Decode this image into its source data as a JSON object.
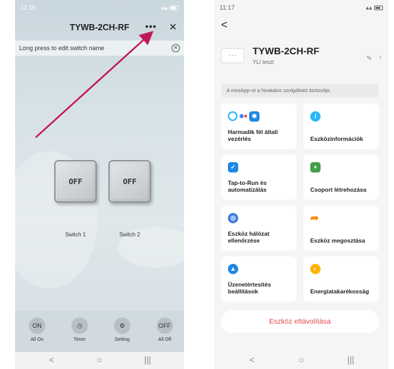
{
  "left": {
    "status_time": "11:16",
    "title": "TYWB-2CH-RF",
    "more_label": "•••",
    "close_label": "✕",
    "notice": "Long press to edit switch name",
    "switches": [
      {
        "state": "OFF",
        "label": "Switch 1"
      },
      {
        "state": "OFF",
        "label": "Switch 2"
      }
    ],
    "bottom_bar": [
      {
        "glyph": "ON",
        "label": "All On"
      },
      {
        "glyph": "◷",
        "label": "Timer"
      },
      {
        "glyph": "⚙",
        "label": "Setting"
      },
      {
        "glyph": "OFF",
        "label": "All Off"
      }
    ],
    "nav": [
      "<",
      "○",
      "|||"
    ],
    "arrow_color": "#c2185b"
  },
  "right": {
    "status_time": "11:17",
    "back_label": "<",
    "device_icon_text": "- - -",
    "device_name": "TYWB-2CH-RF",
    "device_home": "YLI teszt",
    "provider_notice": "A miniApp-ot a hivatalos szolgáltató biztosítja.",
    "cards": [
      {
        "label": "Harmadik fél általi vezérlés",
        "icon": "third-party-icons"
      },
      {
        "label": "Eszközinformációk",
        "icon": "info-icon"
      },
      {
        "label": "Tap-to-Run és automatizálás",
        "icon": "automation-icon"
      },
      {
        "label": "Csoport létrehozása",
        "icon": "group-icon"
      },
      {
        "label": "Eszköz hálózat ellenőrzése",
        "icon": "network-icon"
      },
      {
        "label": "Eszköz megosztása",
        "icon": "share-icon"
      },
      {
        "label": "Üzenetértesítés beállítások",
        "icon": "bell-icon"
      },
      {
        "label": "Energiatakarékosság",
        "icon": "energy-icon"
      }
    ],
    "remove_label": "Eszköz eltávolítása",
    "nav": [
      "<",
      "○",
      "|||"
    ],
    "accent_color": "#1e88e5",
    "danger_color": "#e0474a"
  }
}
